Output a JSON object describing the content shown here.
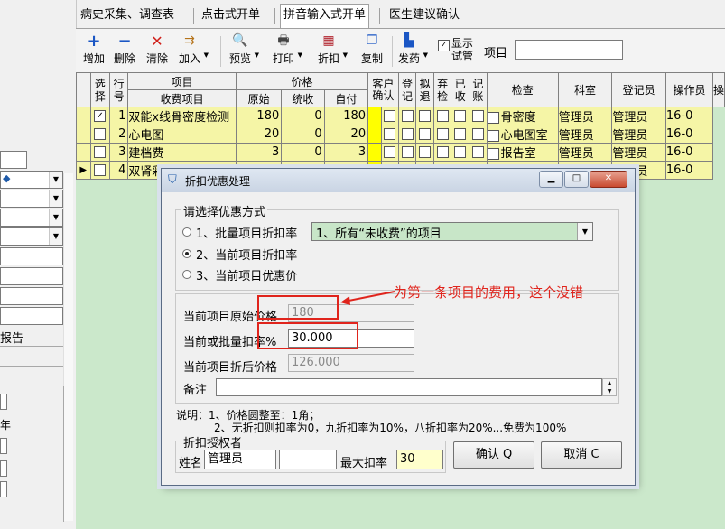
{
  "tabs": [
    "病史采集、调查表",
    "点击式开单",
    "拼音输入式开单",
    "医生建议确认"
  ],
  "active_tab": 2,
  "toolbar": {
    "add": "增加",
    "delete": "删除",
    "clear": "清除",
    "join": "加入",
    "preview": "预览",
    "print": "打印",
    "discount": "折扣",
    "copy": "复制",
    "send": "发药",
    "show_trial": "显示试管",
    "item_label": "项目",
    "item_value": ""
  },
  "left_panel": {
    "report_label": "报告"
  },
  "grid": {
    "headers": {
      "select": "选择",
      "rownum": "行号",
      "item_group": "项目",
      "item": "收费项目",
      "price_group": "价格",
      "original": "原始",
      "collected": "统收",
      "self_pay": "自付",
      "cust_confirm": "客户确认",
      "register": "登记",
      "refund": "拟退",
      "abandon": "弃检",
      "received": "已收",
      "account": "记账",
      "checked": "检查",
      "dept": "科室",
      "registrar": "登记员",
      "operator": "操作员",
      "extra": "操"
    },
    "rows": [
      {
        "checked": true,
        "no": "1",
        "item": "双能x线骨密度检测",
        "original": "180",
        "collected": "0",
        "self_pay": "180",
        "dept": "骨密度",
        "registrar": "管理员",
        "operator": "管理员",
        "extra": "16-0"
      },
      {
        "checked": false,
        "no": "2",
        "item": "心电图",
        "original": "20",
        "collected": "0",
        "self_pay": "20",
        "dept": "心电图室",
        "registrar": "管理员",
        "operator": "管理员",
        "extra": "16-0"
      },
      {
        "checked": false,
        "no": "3",
        "item": "建档费",
        "original": "3",
        "collected": "0",
        "self_pay": "3",
        "dept": "报告室",
        "registrar": "管理员",
        "operator": "管理员",
        "extra": "16-0"
      },
      {
        "checked": false,
        "no": "4",
        "item": "双肾彩超",
        "original": "",
        "collected": "",
        "self_pay": "",
        "dept": "彩超室",
        "registrar": "管理员",
        "operator": "管理员",
        "extra": "16-0"
      }
    ]
  },
  "dialog": {
    "title": "折扣优惠处理",
    "group_title": "请选择优惠方式",
    "opt1": "1、批量项目折扣率",
    "opt1_select": "1、所有“未收费”的项目",
    "opt2": "2、当前项目折扣率",
    "opt3": "3、当前项目优惠价",
    "selected_option": 2,
    "orig_price_label": "当前项目原始价格",
    "orig_price_value": "180",
    "rate_label": "当前或批量扣率%",
    "rate_value": "30.000",
    "discounted_label": "当前项目折后价格",
    "discounted_value": "126.000",
    "remark_label": "备注",
    "remark_value": "",
    "note1": "说明：1、价格圆整至：1角；",
    "note2": "2、无折扣则扣率为0，九折扣率为10%，八折扣率为20%...免费为100%",
    "auth_group": "折扣授权者",
    "name_label": "姓名",
    "name_value": "管理员",
    "name_extra": "",
    "max_rate_label": "最大扣率",
    "max_rate_value": "30",
    "ok": "确认 Q",
    "cancel": "取消 C"
  },
  "annotation": "为第一条项目的费用，这个没错",
  "colors": {
    "annotation": "#e0241c",
    "row_bg": "#f5f5a6",
    "grid_bg": "#cbe8cb",
    "confirm_col": "#ffff00"
  }
}
